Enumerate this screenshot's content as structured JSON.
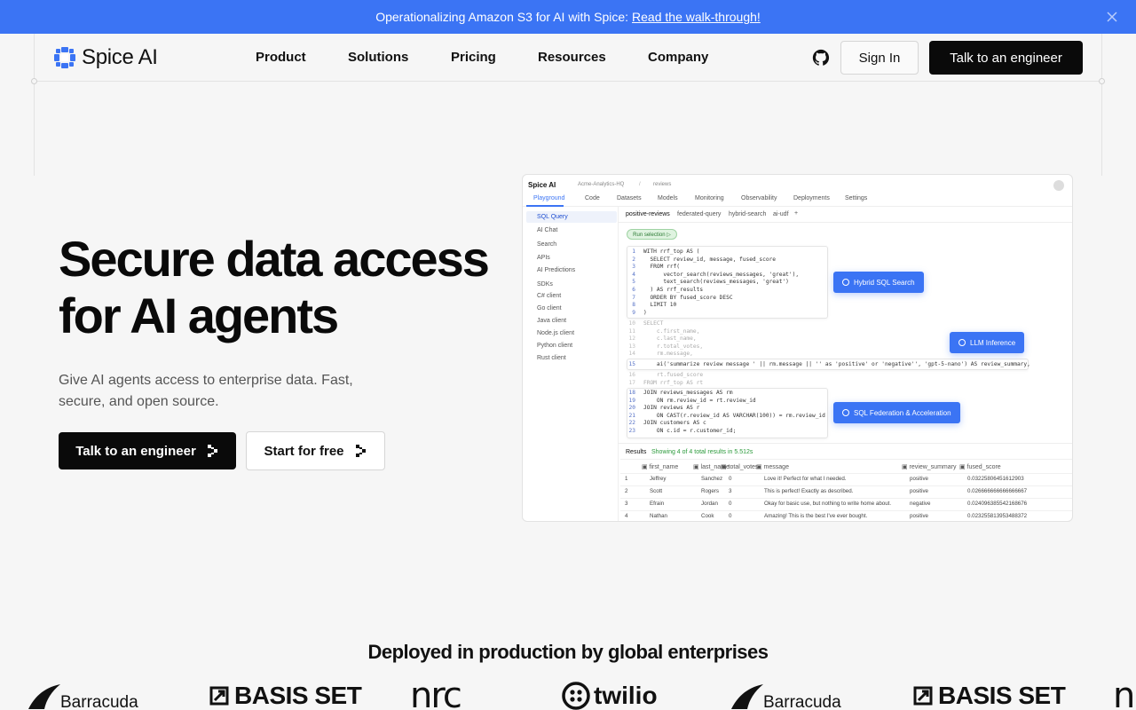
{
  "announcement": {
    "text": "Operationalizing Amazon S3 for AI with Spice:",
    "link": "Read the walk-through!",
    "close_icon": "close-icon"
  },
  "nav": {
    "brand": "Spice AI",
    "items": [
      "Product",
      "Solutions",
      "Pricing",
      "Resources",
      "Company"
    ],
    "github_icon": "github-icon",
    "sign_in": "Sign In",
    "cta": "Talk to an engineer"
  },
  "hero": {
    "title_line1": "Secure data access",
    "title_line2": "for AI agents",
    "subtitle": "Give AI agents access to enterprise data. Fast, secure, and open source.",
    "primary_cta": "Talk to an engineer",
    "secondary_cta": "Start for free"
  },
  "app": {
    "brand": "Spice AI",
    "workspace": "Acme-Analytics-HQ",
    "dataset": "reviews",
    "top_tabs": [
      "Playground",
      "Code",
      "Datasets",
      "Models",
      "Monitoring",
      "Observability",
      "Deployments",
      "Settings"
    ],
    "sidebar": {
      "items": [
        "SQL Query",
        "AI Chat",
        "Search",
        "APIs",
        "AI Predictions",
        "SDKs",
        "C# client",
        "Go client",
        "Java client",
        "Node.js client",
        "Python client",
        "Rust client"
      ]
    },
    "query_tabs": [
      "positive-reviews",
      "federated-query",
      "hybrid-search",
      "ai-udf",
      "+"
    ],
    "run_button": "Run selection ▷",
    "code_lines": [
      "WITH rrf_top AS (",
      "  SELECT review_id, message, fused_score",
      "  FROM rrf(",
      "      vector_search(reviews_messages, 'great'),",
      "      text_search(reviews_messages, 'great')",
      "  ) AS rrf_results",
      "  ORDER BY fused_score DESC",
      "  LIMIT 10",
      ")",
      "SELECT",
      "    c.first_name,",
      "    c.last_name,",
      "    r.total_votes,",
      "    rm.message,",
      "    ai('summarize review message ' || rm.message || '' as 'positive' or 'negative'', 'gpt-5-nano') AS review_summary,",
      "    rt.fused_score",
      "FROM rrf_top AS rt",
      "JOIN reviews_messages AS rm",
      "    ON rm.review_id = rt.review_id",
      "JOIN reviews AS r",
      "    ON CAST(r.review_id AS VARCHAR(100)) = rm.review_id",
      "JOIN customers AS c",
      "    ON c.id = r.customer_id;"
    ],
    "pills": [
      "Hybrid SQL Search",
      "LLM Inference",
      "SQL Federation & Acceleration"
    ],
    "results_label": "Results",
    "results_status": "Showing 4 of 4 total results in 5.512s",
    "columns": [
      "first_name",
      "last_name",
      "total_votes",
      "message",
      "review_summary",
      "fused_score"
    ],
    "rows": [
      [
        "1",
        "Jeffrey",
        "Sanchez",
        "0",
        "Love it! Perfect for what I needed.",
        "positive",
        "0.03225806451612903"
      ],
      [
        "2",
        "Scott",
        "Rogers",
        "3",
        "This is perfect! Exactly as described.",
        "positive",
        "0.026666666666666667"
      ],
      [
        "3",
        "Efrain",
        "Jordan",
        "0",
        "Okay for basic use, but nothing to write home about.",
        "negative",
        "0.024096385542168676"
      ],
      [
        "4",
        "Nathan",
        "Cook",
        "0",
        "Amazing! This is the best I've ever bought.",
        "positive",
        "0.023255813953488372"
      ]
    ]
  },
  "customers": {
    "heading": "Deployed in production by global enterprises",
    "logos": [
      "Barracuda",
      "BASIS SET",
      "nrc",
      "twilio",
      "Barracuda",
      "BASIS SET",
      "n"
    ]
  },
  "colors": {
    "accent": "#3b74f4",
    "dark": "#0a0a0a",
    "background": "#f6f6f6"
  }
}
